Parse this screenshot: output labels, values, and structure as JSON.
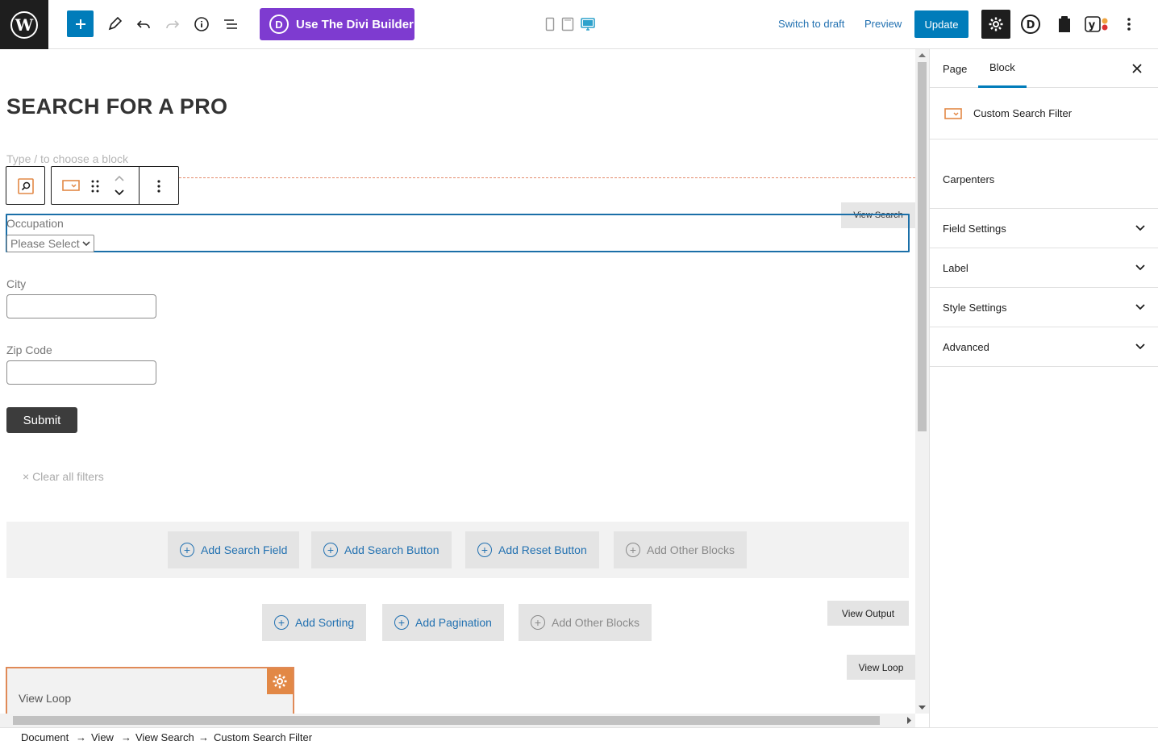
{
  "topbar": {
    "divi_label": "Use The Divi Builder",
    "divi_letter": "D",
    "switch_to_draft": "Switch to draft",
    "preview": "Preview",
    "update": "Update",
    "divi_icon_letter": "D"
  },
  "editor": {
    "page_title": "SEARCH FOR A PRO",
    "block_placeholder": "Type / to choose a block",
    "view_search_tag": "View Search",
    "occupation_label": "Occupation",
    "occupation_select": "Please Select",
    "city_label": "City",
    "zip_label": "Zip Code",
    "submit_label": "Submit",
    "clear_filters": "× Clear all filters",
    "add_buttons": {
      "search_field": "Add Search Field",
      "search_button": "Add Search Button",
      "reset_button": "Add Reset Button",
      "other_blocks_1": "Add Other Blocks",
      "sorting": "Add Sorting",
      "pagination": "Add Pagination",
      "other_blocks_2": "Add Other Blocks"
    },
    "view_output": "View Output",
    "view_loop_tag": "View Loop",
    "view_loop_block_label": "View Loop"
  },
  "sidebar": {
    "tabs": [
      "Page",
      "Block"
    ],
    "active_tab": "Block",
    "block_name": "Custom Search Filter",
    "block_content": "Carpenters",
    "panels": [
      "Field Settings",
      "Label",
      "Style Settings",
      "Advanced"
    ]
  },
  "breadcrumb": {
    "items": [
      "Document",
      "View",
      "View Search",
      "Custom Search Filter"
    ],
    "separator": "→"
  },
  "colors": {
    "wp_blue": "#007cba",
    "divi_purple": "#7e3bd0",
    "orange": "#e28846",
    "selection_blue": "#1b6fa8"
  }
}
